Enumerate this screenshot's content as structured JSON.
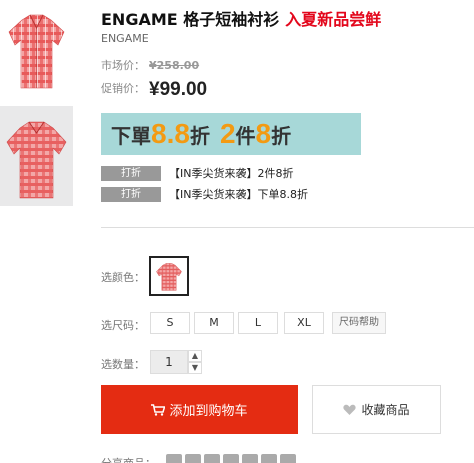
{
  "product": {
    "title": "ENGAME 格子短袖衬衫",
    "promo_title": "入夏新品尝鲜",
    "brand": "ENGAME"
  },
  "price": {
    "market_label": "市场价：",
    "market_value": "¥258.00",
    "sale_label": "促销价：",
    "sale_value": "¥99.00"
  },
  "banner": {
    "part1": "下單",
    "part2": "8.8",
    "part3": "折",
    "part4": "2",
    "part5": "件",
    "part6": "8",
    "part7": "折"
  },
  "promotions": [
    {
      "tag": "打折",
      "text": "【IN季尖货来袭】2件8折"
    },
    {
      "tag": "打折",
      "text": "【IN季尖货来袭】下单8.8折"
    }
  ],
  "options": {
    "color_label": "选颜色：",
    "size_label": "选尺码：",
    "sizes": [
      "S",
      "M",
      "L",
      "XL"
    ],
    "size_help": "尺码帮助",
    "qty_label": "选数量：",
    "qty_value": "1"
  },
  "actions": {
    "add_to_cart": "添加到购物车",
    "favorite": "收藏商品"
  },
  "share": {
    "label": "分享商品："
  },
  "colors": {
    "accent_red": "#e3071c",
    "cart_button": "#e42c12",
    "banner_bg": "#a7d8d8",
    "banner_orange": "#f39a12"
  },
  "icons": [
    "shirt-thumbnail",
    "cart-icon",
    "heart-icon",
    "chevron-up-icon",
    "chevron-down-icon",
    "share-icon"
  ]
}
